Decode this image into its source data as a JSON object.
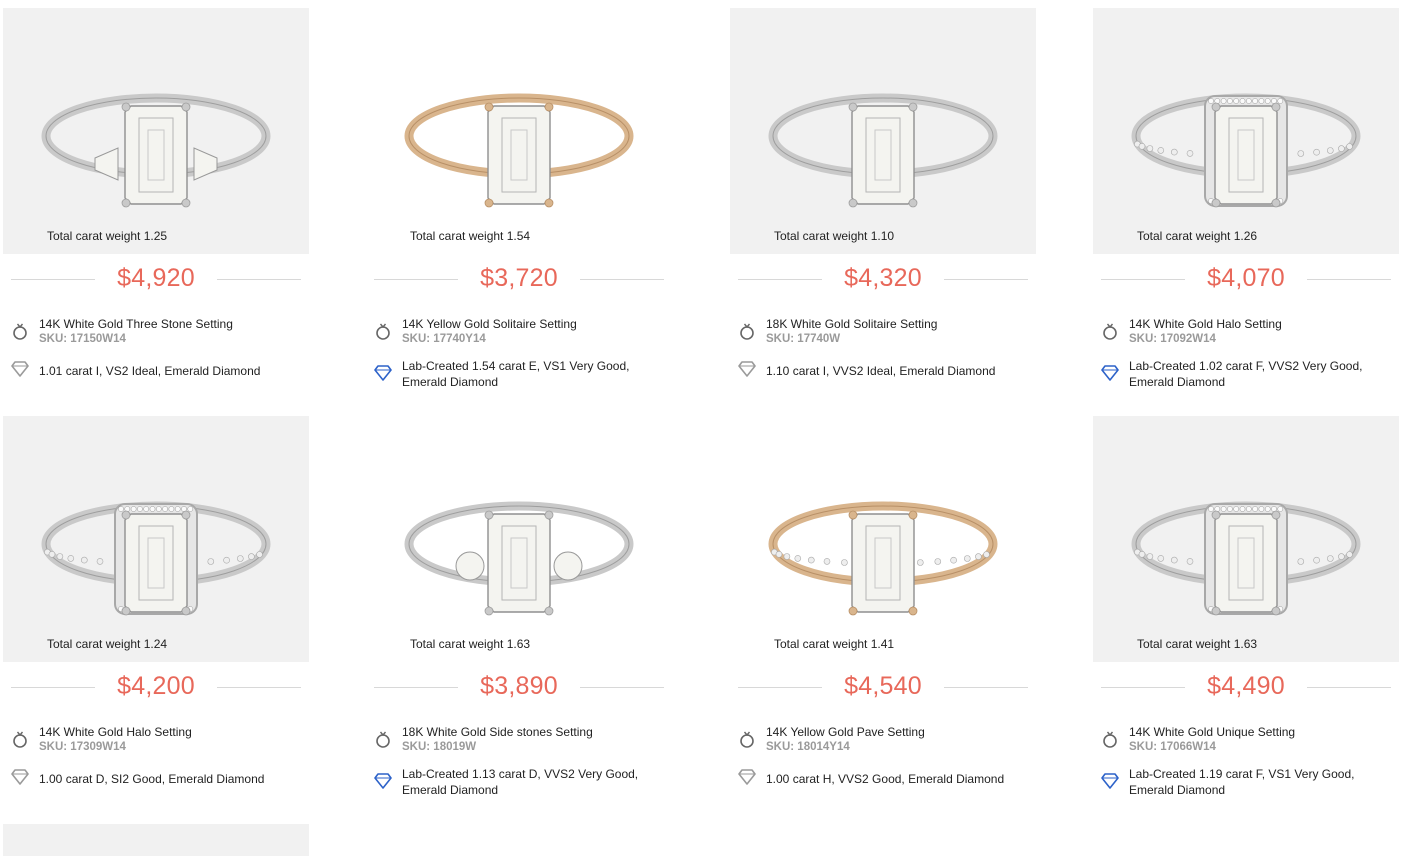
{
  "colors": {
    "price": "#e8685a",
    "lab_icon": "#2d62c9",
    "natural_icon": "#9a9a9a",
    "divider": "#d8d8d8"
  },
  "cards": [
    {
      "carat": "Total carat weight 1.25",
      "price": "$4,920",
      "setting": "14K White Gold Three Stone Setting",
      "sku": "SKU: 17150W14",
      "diamond": "1.01 carat I, VS2 Ideal, Emerald Diamond",
      "lab": false,
      "metal": "white",
      "style": "three-stone",
      "bg": "gray"
    },
    {
      "carat": "Total carat weight 1.54",
      "price": "$3,720",
      "setting": "14K Yellow Gold Solitaire Setting",
      "sku": "SKU: 17740Y14",
      "diamond": "Lab-Created 1.54 carat E, VS1 Very Good, Emerald Diamond",
      "lab": true,
      "metal": "yellow",
      "style": "solitaire",
      "bg": "white"
    },
    {
      "carat": "Total carat weight 1.10",
      "price": "$4,320",
      "setting": "18K White Gold Solitaire Setting",
      "sku": "SKU: 17740W",
      "diamond": "1.10 carat I, VVS2 Ideal, Emerald Diamond",
      "lab": false,
      "metal": "white",
      "style": "solitaire",
      "bg": "gray"
    },
    {
      "carat": "Total carat weight 1.26",
      "price": "$4,070",
      "setting": "14K White Gold Halo Setting",
      "sku": "SKU: 17092W14",
      "diamond": "Lab-Created 1.02 carat F, VVS2 Very Good, Emerald Diamond",
      "lab": true,
      "metal": "white",
      "style": "halo-side",
      "bg": "gray"
    },
    {
      "carat": "Total carat weight 1.24",
      "price": "$4,200",
      "setting": "14K White Gold Halo Setting",
      "sku": "SKU: 17309W14",
      "diamond": "1.00 carat D, SI2 Good, Emerald Diamond",
      "lab": false,
      "metal": "white",
      "style": "halo",
      "bg": "gray"
    },
    {
      "carat": "Total carat weight 1.63",
      "price": "$3,890",
      "setting": "18K White Gold Side stones Setting",
      "sku": "SKU: 18019W",
      "diamond": "Lab-Created 1.13 carat D, VVS2 Very Good, Emerald Diamond",
      "lab": true,
      "metal": "white",
      "style": "side-stones",
      "bg": "white"
    },
    {
      "carat": "Total carat weight 1.41",
      "price": "$4,540",
      "setting": "14K Yellow Gold Pave Setting",
      "sku": "SKU: 18014Y14",
      "diamond": "1.00 carat H, VVS2 Good, Emerald Diamond",
      "lab": false,
      "metal": "yellow",
      "style": "pave",
      "bg": "white"
    },
    {
      "carat": "Total carat weight 1.63",
      "price": "$4,490",
      "setting": "14K White Gold Unique Setting",
      "sku": "SKU: 17066W14",
      "diamond": "Lab-Created 1.19 carat F, VS1 Very Good, Emerald Diamond",
      "lab": true,
      "metal": "white",
      "style": "halo",
      "bg": "gray"
    }
  ]
}
